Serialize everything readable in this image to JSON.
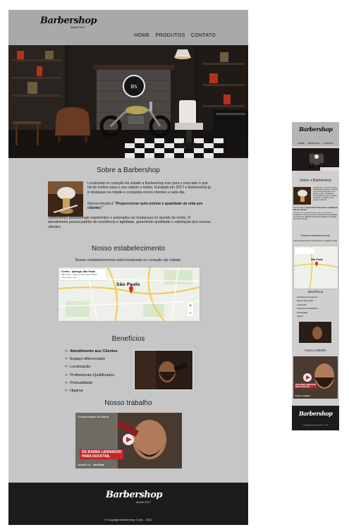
{
  "brand": {
    "name": "Barbershop",
    "since": "desde 2017"
  },
  "nav": [
    "HOME",
    "PRODUTOS",
    "CONTATO"
  ],
  "about": {
    "title": "Sobre a Barbershop",
    "body": "Localizada no coração da cidade a Barbershop traz para o mercado o que há de melhor para o seu cabelo e barba. Fundada em 2017 a Barbershop já é destaque na cidade e conquista novos clientes a cada dia.",
    "mission_label": "Nossa missão é",
    "mission": "\"Proporcionar auto-estima e qualidade de vida aos clientes\"",
    "extra": "Oferecemos profissionais experientes e antenados às mudanças no mundo da moda. O atendimento possui padrão de excelência e agilidade, garantindo qualidade e satisfação dos nossos clientes."
  },
  "location": {
    "title": "Nosso estabelecimento",
    "caption": "Nosso estabelecimento está localizado no coração da cidade.",
    "map_card_title": "Centro - Ipiranga, São Paulo",
    "map_card_sub": "São Paulo - State of São Paulo, Brazil",
    "map_city": "São Paulo",
    "view_larger": "View larger map"
  },
  "benefits": {
    "title": "Benefícios",
    "items": [
      "Atendimento aos Clientes",
      "Espaço diferenciado",
      "Localização",
      "Profissionais Qualificados",
      "Pontualidade",
      "Higiene"
    ]
  },
  "work": {
    "title": "Nosso trabalho",
    "video_title": "Transformação de Barba",
    "banner_line1": "DE BARBA LENHADOR",
    "banner_line2": "PARA DUCKTAIL",
    "watch_on": "Assistir no",
    "youtube": "YouTube"
  },
  "footer": {
    "copyright": "© Copyright Barbershop Curso - 2021"
  },
  "colors": {
    "header_gray": "#a9a9a9",
    "body_gray": "#c6c6c6",
    "footer_dark": "#1c1c1c",
    "accent_red": "#c0292b"
  }
}
